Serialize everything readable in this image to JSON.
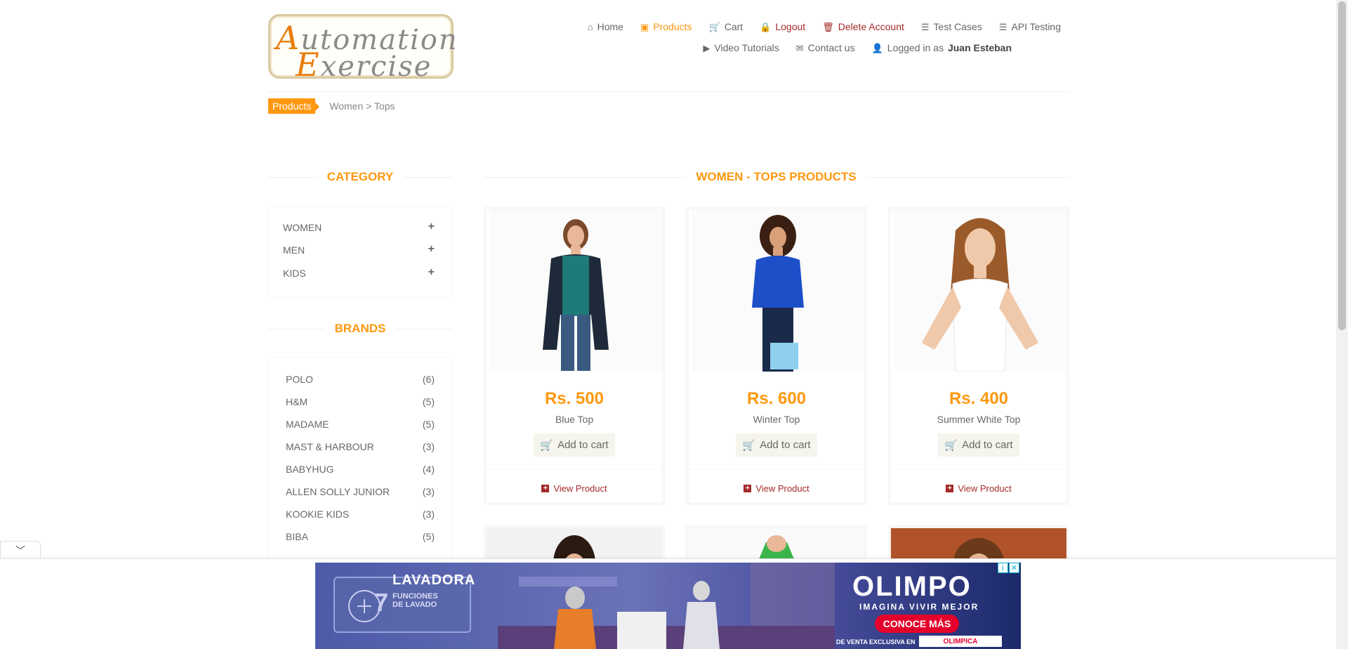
{
  "logo": {
    "line1_cap": "A",
    "line1_rest": "utomation",
    "line2_cap": "E",
    "line2_rest": "xercise"
  },
  "nav": {
    "row1": [
      {
        "id": "home",
        "icon": "home-icon",
        "glyph": "⌂",
        "label": "Home"
      },
      {
        "id": "products",
        "icon": "products-icon",
        "glyph": "▣",
        "label": "Products"
      },
      {
        "id": "cart",
        "icon": "cart-icon",
        "glyph": "🛒",
        "label": "Cart"
      },
      {
        "id": "logout",
        "icon": "lock-icon",
        "glyph": "🔒",
        "label": "Logout"
      },
      {
        "id": "delete-account",
        "icon": "trash-icon",
        "glyph": "🗑",
        "label": "Delete Account"
      },
      {
        "id": "test-cases",
        "icon": "list-icon",
        "glyph": "☰",
        "label": "Test Cases"
      },
      {
        "id": "api-testing",
        "icon": "list-icon",
        "glyph": "☰",
        "label": "API Testing"
      }
    ],
    "row2": [
      {
        "id": "video-tutorials",
        "icon": "youtube-icon",
        "glyph": "▶",
        "label": "Video Tutorials"
      },
      {
        "id": "contact-us",
        "icon": "envelope-icon",
        "glyph": "✉",
        "label": "Contact us"
      }
    ],
    "logged_in_prefix": "Logged in as",
    "logged_in_user": "Juan Esteban"
  },
  "breadcrumb": {
    "tag": "Products",
    "path": "Women > Tops"
  },
  "sidebar": {
    "category_title": "Category",
    "categories": [
      "WOMEN",
      "MEN",
      "KIDS"
    ],
    "brands_title": "Brands",
    "brands": [
      {
        "name": "POLO",
        "count": "(6)"
      },
      {
        "name": "H&M",
        "count": "(5)"
      },
      {
        "name": "MADAME",
        "count": "(5)"
      },
      {
        "name": "MAST & HARBOUR",
        "count": "(3)"
      },
      {
        "name": "BABYHUG",
        "count": "(4)"
      },
      {
        "name": "ALLEN SOLLY JUNIOR",
        "count": "(3)"
      },
      {
        "name": "KOOKIE KIDS",
        "count": "(3)"
      },
      {
        "name": "BIBA",
        "count": "(5)"
      }
    ]
  },
  "main": {
    "title": "Women - Tops Products",
    "add_to_cart": "Add to cart",
    "view_product": "View Product",
    "products": [
      {
        "price": "Rs. 500",
        "name": "Blue Top",
        "top_color": "#1f7a7a",
        "jacket_color": "#1e2a3a",
        "pants_color": "#3a5a80",
        "hair_color": "#7a4a2a"
      },
      {
        "price": "Rs. 600",
        "name": "Winter Top",
        "top_color": "#1d4fc9",
        "jacket_color": "#1d4fc9",
        "pants_color": "#1a2a4a",
        "hair_color": "#3a2012"
      },
      {
        "price": "Rs. 400",
        "name": "Summer White Top",
        "top_color": "#ffffff",
        "jacket_color": "#ffffff",
        "pants_color": "#f5f5f5",
        "hair_color": "#9a5a2a"
      }
    ]
  },
  "ad": {
    "lavadora": "LAVADORA",
    "seven": "7",
    "funciones_1": "FUNCIONES",
    "funciones_2": "DE LAVADO",
    "brand": "OLIMPO",
    "tagline": "IMAGINA VIVIR MEJOR",
    "cta": "CONOCE MÁS",
    "venta": "DE VENTA EXCLUSIVA EN",
    "store": "OLIMPICA"
  }
}
